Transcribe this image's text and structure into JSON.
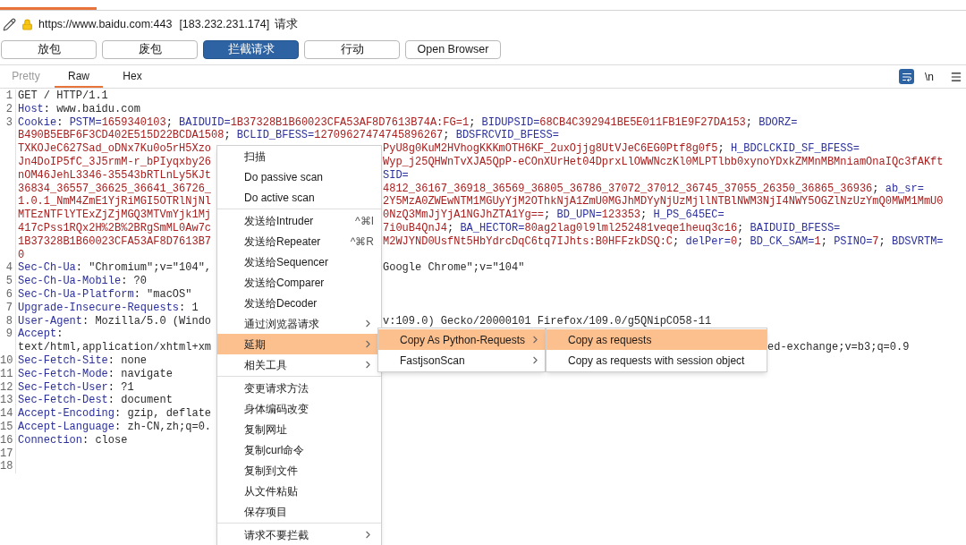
{
  "request_bar": {
    "url": "https://www.baidu.com:443",
    "address": "[183.232.231.174]",
    "direction": "请求"
  },
  "actions": [
    {
      "label": "放包",
      "selected": false
    },
    {
      "label": "废包",
      "selected": false
    },
    {
      "label": "拦截请求",
      "selected": true
    },
    {
      "label": "行动",
      "selected": false
    },
    {
      "label": "Open Browser",
      "selected": false
    }
  ],
  "view_tabs": [
    {
      "label": "Pretty",
      "selected": false,
      "disabled": true
    },
    {
      "label": "Raw",
      "selected": true,
      "disabled": false
    },
    {
      "label": "Hex",
      "selected": false,
      "disabled": false
    }
  ],
  "newline_toggle": "\\n",
  "editor": {
    "rows": [
      {
        "number": "1",
        "left": [
          {
            "kind": "plain",
            "text": "GET / HTTP/1.1"
          }
        ]
      },
      {
        "number": "2",
        "left": [
          {
            "kind": "name",
            "text": "Host"
          },
          {
            "kind": "plain",
            "text": ": www.baidu.com"
          }
        ]
      },
      {
        "number": "3",
        "left": [
          {
            "kind": "name",
            "text": "Cookie"
          },
          {
            "kind": "plain",
            "text": ": "
          },
          {
            "kind": "name",
            "text": "PSTM="
          },
          {
            "kind": "value",
            "text": "1659340103"
          },
          {
            "kind": "plain",
            "text": "; "
          },
          {
            "kind": "name",
            "text": "BAIDUID="
          },
          {
            "kind": "value",
            "text": "1B37328B1B60023CFA53AF8D7613B74A:FG=1"
          },
          {
            "kind": "plain",
            "text": "; "
          },
          {
            "kind": "name",
            "text": "BIDUPSID="
          },
          {
            "kind": "value",
            "text": "68CB4C392941BE5E011FB1E9F27DA153"
          },
          {
            "kind": "plain",
            "text": "; "
          },
          {
            "kind": "name",
            "text": "BDORZ="
          }
        ]
      },
      {
        "left": [
          {
            "kind": "value",
            "text": "B490B5EBF6F3CD402E515D22BCDA1508"
          },
          {
            "kind": "plain",
            "text": "; "
          },
          {
            "kind": "name",
            "text": "BCLID_BFESS="
          },
          {
            "kind": "value",
            "text": "12709627474745896267"
          },
          {
            "kind": "plain",
            "text": "; "
          },
          {
            "kind": "name",
            "text": "BDSFRCVID_BFESS="
          }
        ]
      },
      {
        "left": [
          {
            "kind": "value",
            "text": "TXKOJeC627Sad_oDNx7Ku0o5rH5Xzo"
          }
        ],
        "right": [
          {
            "kind": "value",
            "text": "PyU8g0KuM2HVhogKKKmOTH6KF_2uxOjjg8UtVJeC6EG0Ptf8g0f5"
          },
          {
            "kind": "plain",
            "text": "; "
          },
          {
            "kind": "name",
            "text": "H_BDCLCKID_SF_BFESS="
          }
        ]
      },
      {
        "left": [
          {
            "kind": "value",
            "text": "Jn4DoIP5fC_3J5rmM-r_bPIyqxby26"
          }
        ],
        "right": [
          {
            "kind": "value",
            "text": "Wyp_j25QHWnTvXJA5QpP-eCOnXUrHet04DprxLlOWWNczKl0MLPTlbb0xynoYDxkZMMnMBMniamOnaIQc3fAKft"
          }
        ]
      },
      {
        "left": [
          {
            "kind": "value",
            "text": "nOM46JehL3346-35543bRTLnLy5KJt"
          }
        ],
        "right": [
          {
            "kind": "name",
            "text": "SID="
          }
        ]
      },
      {
        "left": [
          {
            "kind": "value",
            "text": "36834_36557_36625_36641_36726_"
          }
        ],
        "right": [
          {
            "kind": "value",
            "text": "4812_36167_36918_36569_36805_36786_37072_37012_36745_37055_26350_36865_36936"
          },
          {
            "kind": "plain",
            "text": "; "
          },
          {
            "kind": "name",
            "text": "ab_sr="
          }
        ]
      },
      {
        "left": [
          {
            "kind": "value",
            "text": "1.0.1_NmM4ZmE1YjRiMGI5OTRlNjNl"
          }
        ],
        "right": [
          {
            "kind": "value",
            "text": "2Y5MzA0ZWEwNTM1MGUyYjM2OThkNjA1ZmU0MGJhMDYyNjUzMjllNTBlNWM3NjI4NWY5OGZlNzUzYmQ0MWM1MmU0"
          }
        ]
      },
      {
        "left": [
          {
            "kind": "value",
            "text": "MTEzNTFlYTExZjZjMGQ3MTVmYjk1Mj"
          }
        ],
        "right": [
          {
            "kind": "value",
            "text": "0NzQ3MmJjYjA1NGJhZTA1Yg=="
          },
          {
            "kind": "plain",
            "text": "; "
          },
          {
            "kind": "name",
            "text": "BD_UPN="
          },
          {
            "kind": "value",
            "text": "123353"
          },
          {
            "kind": "plain",
            "text": "; "
          },
          {
            "kind": "name",
            "text": "H_PS_645EC="
          }
        ]
      },
      {
        "left": [
          {
            "kind": "value",
            "text": "417cPss1RQx2H%2B%2BRgSmML0Aw7c"
          }
        ],
        "right": [
          {
            "kind": "value",
            "text": "7i0uB4QnJ4"
          },
          {
            "kind": "plain",
            "text": "; "
          },
          {
            "kind": "name",
            "text": "BA_HECTOR="
          },
          {
            "kind": "value",
            "text": "80ag2lag0l9lml252481veqe1heuq3c16"
          },
          {
            "kind": "plain",
            "text": "; "
          },
          {
            "kind": "name",
            "text": "BAIDUID_BFESS="
          }
        ]
      },
      {
        "left": [
          {
            "kind": "value",
            "text": "1B37328B1B60023CFA53AF8D7613B7"
          }
        ],
        "right": [
          {
            "kind": "value",
            "text": "M2WJYND0UsfNt5HbYdrcDqC6tq7IJhts:B0HFFzkDSQ:C"
          },
          {
            "kind": "plain",
            "text": "; "
          },
          {
            "kind": "name",
            "text": "delPer="
          },
          {
            "kind": "value",
            "text": "0"
          },
          {
            "kind": "plain",
            "text": "; "
          },
          {
            "kind": "name",
            "text": "BD_CK_SAM="
          },
          {
            "kind": "value",
            "text": "1"
          },
          {
            "kind": "plain",
            "text": "; "
          },
          {
            "kind": "name",
            "text": "PSINO="
          },
          {
            "kind": "value",
            "text": "7"
          },
          {
            "kind": "plain",
            "text": "; "
          },
          {
            "kind": "name",
            "text": "BDSVRTM="
          }
        ]
      },
      {
        "left": [
          {
            "kind": "value",
            "text": "0"
          }
        ]
      },
      {
        "number": "4",
        "left": [
          {
            "kind": "name",
            "text": "Sec-Ch-Ua"
          },
          {
            "kind": "plain",
            "text": ": \"Chromium\";v=\"104\","
          }
        ],
        "right": [
          {
            "kind": "plain",
            "text": "Google Chrome\";v=\"104\""
          }
        ]
      },
      {
        "number": "5",
        "left": [
          {
            "kind": "name",
            "text": "Sec-Ch-Ua-Mobile"
          },
          {
            "kind": "plain",
            "text": ": ?0"
          }
        ]
      },
      {
        "number": "6",
        "left": [
          {
            "kind": "name",
            "text": "Sec-Ch-Ua-Platform"
          },
          {
            "kind": "plain",
            "text": ": \"macOS\""
          }
        ]
      },
      {
        "number": "7",
        "left": [
          {
            "kind": "name",
            "text": "Upgrade-Insecure-Requests"
          },
          {
            "kind": "plain",
            "text": ": 1"
          }
        ]
      },
      {
        "number": "8",
        "left": [
          {
            "kind": "name",
            "text": "User-Agent"
          },
          {
            "kind": "plain",
            "text": ": Mozilla/5.0 (Windo"
          }
        ],
        "right": [
          {
            "kind": "plain",
            "text": "v:109.0) Gecko/20000101 Firefox/109.0/g5QNipCO58-11"
          }
        ]
      },
      {
        "number": "9",
        "left": [
          {
            "kind": "name",
            "text": "Accept"
          },
          {
            "kind": "plain",
            "text": ":"
          }
        ]
      },
      {
        "left": [
          {
            "kind": "plain",
            "text": "text/html,application/xhtml+xm"
          }
        ],
        "right": [
          {
            "kind": "plain",
            "text": "ed-exchange;v=b3;q=0.9"
          }
        ]
      },
      {
        "number": "10",
        "left": [
          {
            "kind": "name",
            "text": "Sec-Fetch-Site"
          },
          {
            "kind": "plain",
            "text": ": none"
          }
        ]
      },
      {
        "number": "11",
        "left": [
          {
            "kind": "name",
            "text": "Sec-Fetch-Mode"
          },
          {
            "kind": "plain",
            "text": ": navigate"
          }
        ]
      },
      {
        "number": "12",
        "left": [
          {
            "kind": "name",
            "text": "Sec-Fetch-User"
          },
          {
            "kind": "plain",
            "text": ": ?1"
          }
        ]
      },
      {
        "number": "13",
        "left": [
          {
            "kind": "name",
            "text": "Sec-Fetch-Dest"
          },
          {
            "kind": "plain",
            "text": ": document"
          }
        ]
      },
      {
        "number": "14",
        "left": [
          {
            "kind": "name",
            "text": "Accept-Encoding"
          },
          {
            "kind": "plain",
            "text": ": gzip, deflate"
          }
        ]
      },
      {
        "number": "15",
        "left": [
          {
            "kind": "name",
            "text": "Accept-Language"
          },
          {
            "kind": "plain",
            "text": ": zh-CN,zh;q=0."
          }
        ]
      },
      {
        "number": "16",
        "left": [
          {
            "kind": "name",
            "text": "Connection"
          },
          {
            "kind": "plain",
            "text": ": close"
          }
        ]
      },
      {
        "number": "17"
      },
      {
        "number": "18"
      }
    ]
  },
  "context_menu": {
    "groups": [
      [
        {
          "label": "扫描",
          "selected": false
        },
        {
          "label": "Do passive scan",
          "selected": false
        },
        {
          "label": "Do active scan",
          "selected": false
        }
      ],
      [
        {
          "label": "发送给Intruder",
          "shortcut": "^⌘I",
          "selected": false
        },
        {
          "label": "发送给Repeater",
          "shortcut": "^⌘R",
          "selected": false
        },
        {
          "label": "发送给Sequencer",
          "selected": false
        },
        {
          "label": "发送给Comparer",
          "selected": false
        },
        {
          "label": "发送给Decoder",
          "selected": false
        },
        {
          "label": "通过浏览器请求",
          "has_submenu": true,
          "selected": false
        },
        {
          "label": "延期",
          "has_submenu": true,
          "selected": true,
          "children": [
            {
              "label": "Copy As Python-Requests",
              "has_submenu": true,
              "selected": true,
              "children": [
                {
                  "label": "Copy as requests",
                  "selected": true
                },
                {
                  "label": "Copy as requests with session object",
                  "selected": false
                }
              ]
            },
            {
              "label": "FastjsonScan",
              "has_submenu": true,
              "selected": false
            }
          ]
        },
        {
          "label": "相关工具",
          "has_submenu": true,
          "selected": false
        }
      ],
      [
        {
          "label": "变更请求方法",
          "selected": false
        },
        {
          "label": "身体编码改变",
          "selected": false
        },
        {
          "label": "复制网址",
          "selected": false
        },
        {
          "label": "复制curl命令",
          "selected": false
        },
        {
          "label": "复制到文件",
          "selected": false
        },
        {
          "label": "从文件粘贴",
          "selected": false
        },
        {
          "label": "保存项目",
          "selected": false
        }
      ],
      [
        {
          "label": "请求不要拦截",
          "has_submenu": true,
          "selected": false
        }
      ]
    ]
  }
}
